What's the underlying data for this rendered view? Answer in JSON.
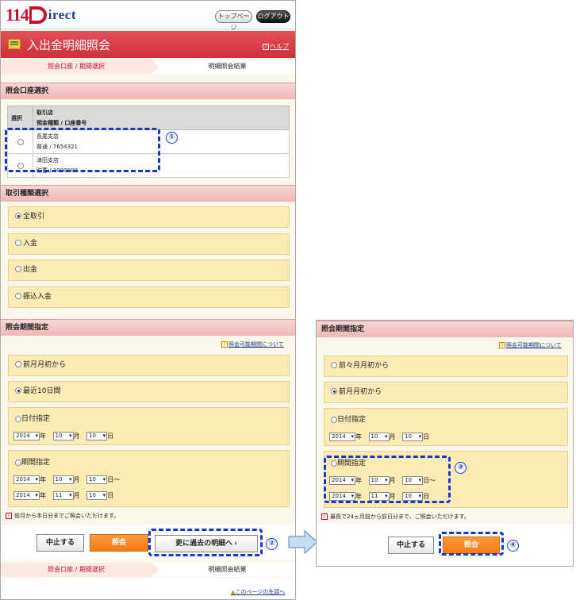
{
  "header": {
    "logo_num": "114",
    "logo_irect": "irect",
    "top_button": "トップページ",
    "logout_button": "ログアウト"
  },
  "title": {
    "text": "入出金明細照会",
    "help": "ヘルプ",
    "help_icon": "?"
  },
  "steps": {
    "step1": "照会口座 / 期間選択",
    "step2": "明細照会結果"
  },
  "account_section": {
    "heading": "照会口座選択",
    "col_select": "選択",
    "col_branch": "取引店",
    "col_type": "預金種類 / 口座番号",
    "rows": [
      {
        "branch": "長尾支店",
        "account": "普通 / 7654321"
      },
      {
        "branch": "津田支店",
        "account": "貯蓄 / 1909090"
      }
    ]
  },
  "txn_section": {
    "heading": "取引種類選択",
    "options": [
      "全取引",
      "入金",
      "出金",
      "振込入金"
    ],
    "selected_index": 0
  },
  "period_left": {
    "heading": "照会期間指定",
    "link": "照会可能期間について",
    "link_icon": "?",
    "opt1": "前月月初から",
    "opt2": "最近10日間",
    "opt3": "日付指定",
    "opt4": "期間指定",
    "selected": "最近10日間",
    "date_single": {
      "year": "2014",
      "month": "10",
      "day": "10"
    },
    "range_from": {
      "year": "2014",
      "month": "10",
      "day": "10"
    },
    "range_to": {
      "year": "2014",
      "month": "11",
      "day": "10"
    },
    "unit_year": "年",
    "unit_month": "月",
    "unit_day": "日",
    "tilde": "～",
    "note": "前月から本日分までご照会いただけます。",
    "note_icon": "!"
  },
  "buttons_left": {
    "cancel": "中止する",
    "inquire": "照会",
    "past": "更に過去の明細へ",
    "past_arrow": "›"
  },
  "footer": {
    "step1": "照会口座 / 期間選択",
    "step2": "明細照会結果",
    "page_top": "このページの先頭へ"
  },
  "period_right": {
    "heading": "照会期間指定",
    "link": "照会可能期間について",
    "link_icon": "?",
    "opt1": "前々月月初から",
    "opt2": "前月月初から",
    "opt3": "日付指定",
    "opt4": "期間指定",
    "selected": "前月月初から",
    "date_single": {
      "year": "2014",
      "month": "10",
      "day": "10"
    },
    "range_from": {
      "year": "2014",
      "month": "10",
      "day": "10"
    },
    "range_to": {
      "year": "2014",
      "month": "11",
      "day": "10"
    },
    "note": "最長で24ヵ月前から前日分まで、ご照会いただけます。",
    "note_icon": "!"
  },
  "buttons_right": {
    "cancel": "中止する",
    "inquire": "照会"
  },
  "markers": [
    "①",
    "②",
    "③",
    "④"
  ],
  "colors": {
    "brand_red": "#c8102e",
    "title_bar": "#d93a42",
    "section_bg": "#fdebb5",
    "button_orange": "#f57c14",
    "annotation_blue": "#1836c7"
  }
}
